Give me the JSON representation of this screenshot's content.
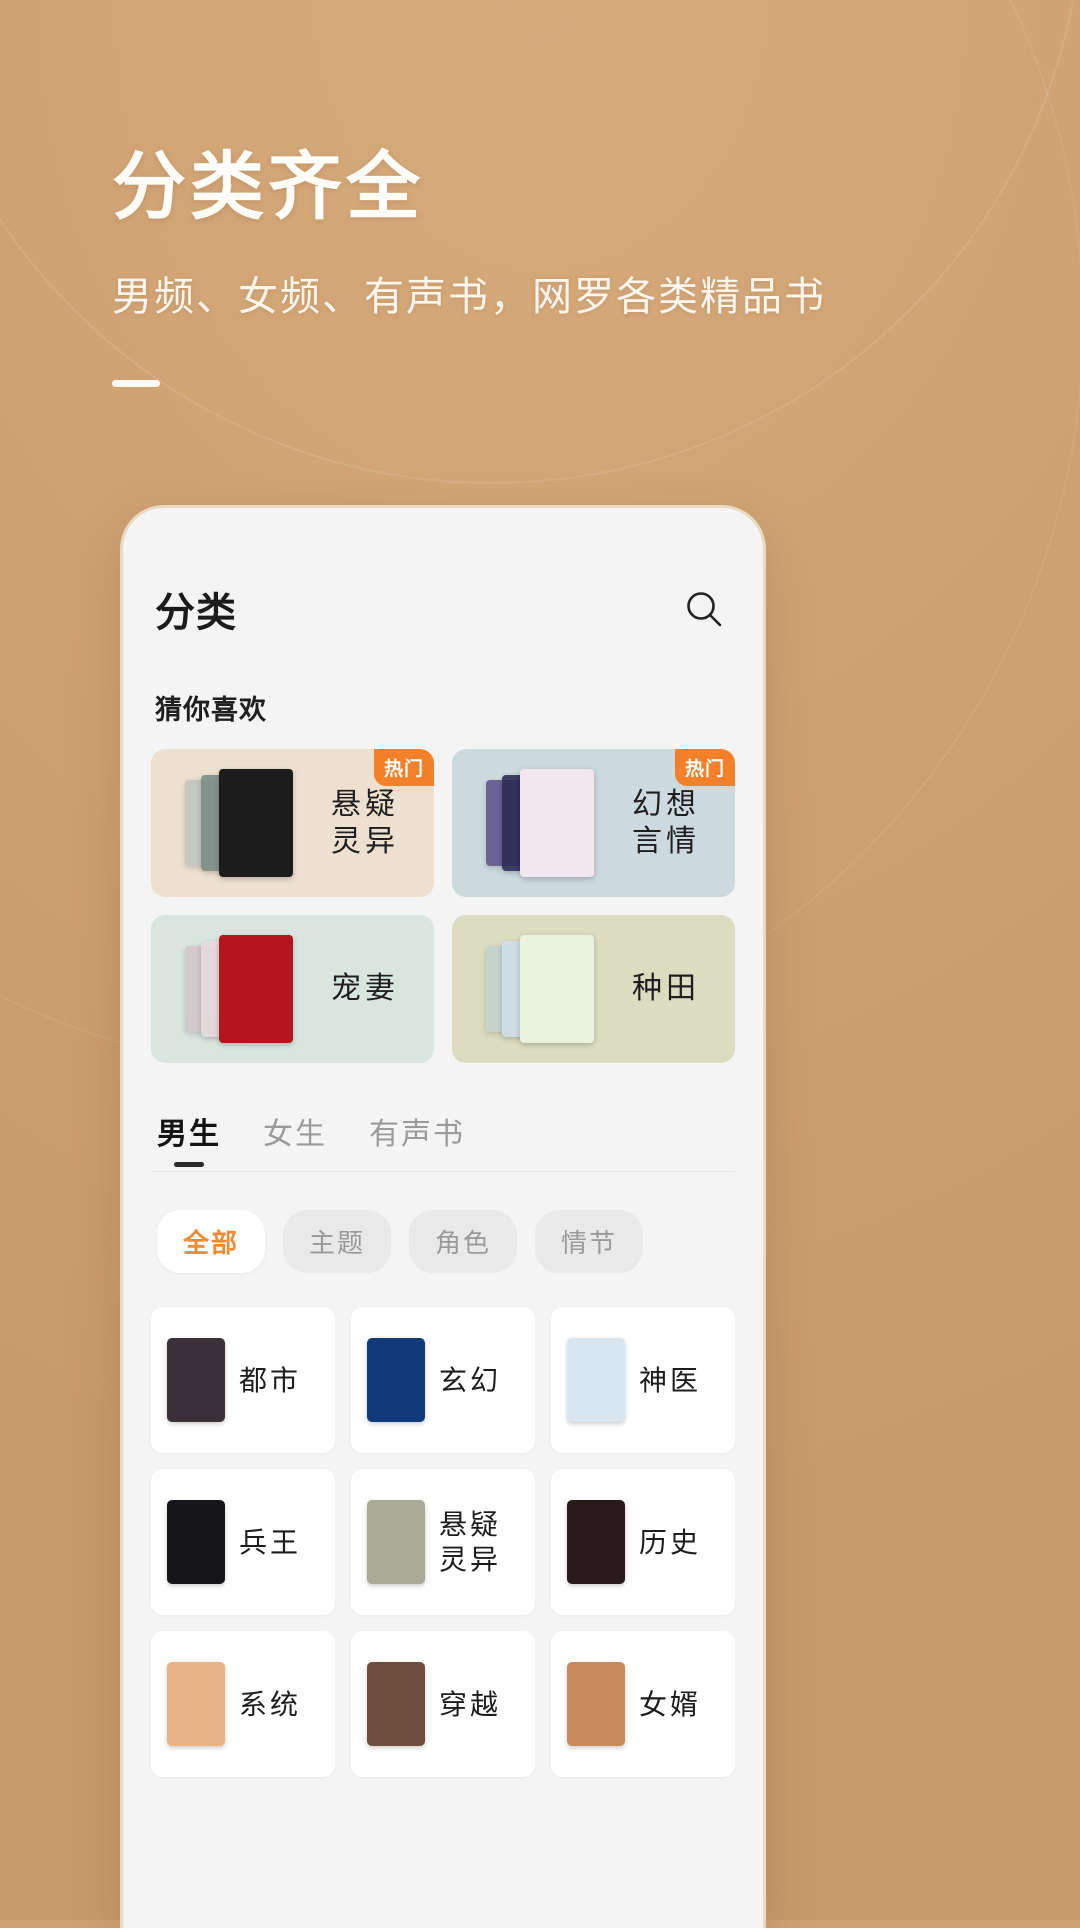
{
  "hero": {
    "title": "分类齐全",
    "subtitle": "男频、女频、有声书，网罗各类精品书"
  },
  "app": {
    "title": "分类",
    "search_icon": "search-icon",
    "recommend_section_title": "猜你喜欢",
    "hot_badge": "热门",
    "recommendations": [
      {
        "label": "悬疑\n灵异",
        "hot": true,
        "bg": "#ede0cf",
        "cover_front": "#1c1c1c",
        "cover_mid": "#7b8b86",
        "cover_back": "#b9bfbb"
      },
      {
        "label": "幻想\n言情",
        "hot": true,
        "bg": "#ccd9de",
        "cover_front": "#f2e7ef",
        "cover_mid": "#2c2a55",
        "cover_back": "#4a3c7a"
      },
      {
        "label": "宠妻",
        "hot": false,
        "bg": "#d9e6e0",
        "cover_front": "#b4161d",
        "cover_mid": "#e7d9dd",
        "cover_back": "#cfc0c4"
      },
      {
        "label": "种田",
        "hot": false,
        "bg": "#dcdcc0",
        "cover_front": "#e9f2dd",
        "cover_mid": "#cfe0ea",
        "cover_back": "#bcd0cf"
      }
    ],
    "tabs": [
      {
        "label": "男生",
        "active": true
      },
      {
        "label": "女生",
        "active": false
      },
      {
        "label": "有声书",
        "active": false
      }
    ],
    "chips": [
      {
        "label": "全部",
        "active": true
      },
      {
        "label": "主题",
        "active": false
      },
      {
        "label": "角色",
        "active": false
      },
      {
        "label": "情节",
        "active": false
      }
    ],
    "categories": [
      {
        "label": "都市",
        "cover": "#3b2f3a"
      },
      {
        "label": "玄幻",
        "cover": "#103a7a"
      },
      {
        "label": "神医",
        "cover": "#d8e6f2"
      },
      {
        "label": "兵王",
        "cover": "#16161a"
      },
      {
        "label": "悬疑\n灵异",
        "cover": "#a9ab96"
      },
      {
        "label": "历史",
        "cover": "#2a1a1c"
      },
      {
        "label": "系统",
        "cover": "#e8b486"
      },
      {
        "label": "穿越",
        "cover": "#6d4e3c"
      },
      {
        "label": "女婿",
        "cover": "#c98a5e"
      }
    ]
  },
  "colors": {
    "background": "#cfa274",
    "accent_orange": "#f5802a",
    "chip_active_text": "#ef8b35",
    "phone_bg": "#f4f4f4"
  }
}
